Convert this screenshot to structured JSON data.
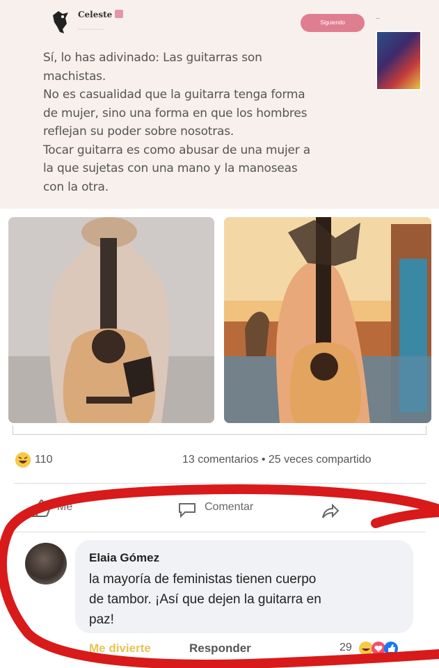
{
  "post": {
    "author": "Celeste",
    "follow_label": "Siguiendo",
    "text": "Sí, lo has adivinado: Las guitarras son\nmachistas.\nNo es casualidad que la guitarra tenga forma\nde mujer, sino una forma en que los hombres\nreflejan su poder sobre nosotras.\nTocar guitarra es como abusar de una mujer a\nla que sujetas con una mano y la manoseas\ncon la otra."
  },
  "stats": {
    "reaction_count": "110",
    "summary": "13 comentarios • 25 veces compartido"
  },
  "actions": {
    "like_label": "Me",
    "comment_label": "Comentar"
  },
  "comment": {
    "name": "Elaia Gómez",
    "text": "la mayoría de feministas tienen cuerpo\nde tambor. ¡Así que dejen la guitarra en\npaz!",
    "react_label": "Me divierte",
    "reply_label": "Responder",
    "reaction_count": "29"
  },
  "colors": {
    "card_bg": "#f7f0ec",
    "follow_btn": "#e07e91",
    "red_mark": "#d81a1a",
    "haha_yellow": "#f7c948"
  },
  "icons": [
    "bird-avatar-icon",
    "more-icon",
    "haha-icon",
    "like-icon",
    "comment-icon",
    "share-icon",
    "love-icon",
    "like-badge-icon"
  ]
}
